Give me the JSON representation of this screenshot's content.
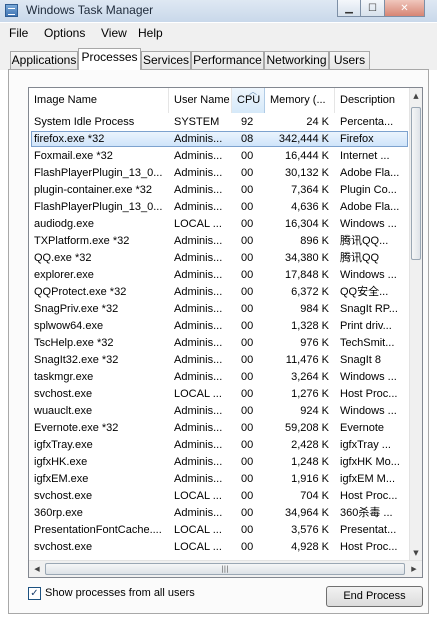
{
  "window": {
    "title": "Windows Task Manager",
    "controls": [
      "minimize",
      "maximize",
      "close"
    ]
  },
  "menu": [
    "File",
    "Options",
    "View",
    "Help"
  ],
  "tabs": [
    "Applications",
    "Processes",
    "Services",
    "Performance",
    "Networking",
    "Users"
  ],
  "active_tab": "Processes",
  "columns": [
    "Image Name",
    "User Name",
    "CPU",
    "Memory (...",
    "Description"
  ],
  "sorted_column": "CPU",
  "selected_row": 1,
  "rows": [
    {
      "name": "System Idle Process",
      "user": "SYSTEM",
      "cpu": "92",
      "mem": "24 K",
      "desc": "Percenta..."
    },
    {
      "name": "firefox.exe *32",
      "user": "Adminis...",
      "cpu": "08",
      "mem": "342,444 K",
      "desc": "Firefox"
    },
    {
      "name": "Foxmail.exe *32",
      "user": "Adminis...",
      "cpu": "00",
      "mem": "16,444 K",
      "desc": "Internet ..."
    },
    {
      "name": "FlashPlayerPlugin_13_0...",
      "user": "Adminis...",
      "cpu": "00",
      "mem": "30,132 K",
      "desc": "Adobe Fla..."
    },
    {
      "name": "plugin-container.exe *32",
      "user": "Adminis...",
      "cpu": "00",
      "mem": "7,364 K",
      "desc": "Plugin Co..."
    },
    {
      "name": "FlashPlayerPlugin_13_0...",
      "user": "Adminis...",
      "cpu": "00",
      "mem": "4,636 K",
      "desc": "Adobe Fla..."
    },
    {
      "name": "audiodg.exe",
      "user": "LOCAL ...",
      "cpu": "00",
      "mem": "16,304 K",
      "desc": "Windows ..."
    },
    {
      "name": "TXPlatform.exe *32",
      "user": "Adminis...",
      "cpu": "00",
      "mem": "896 K",
      "desc": "腾讯QQ..."
    },
    {
      "name": "QQ.exe *32",
      "user": "Adminis...",
      "cpu": "00",
      "mem": "34,380 K",
      "desc": "腾讯QQ"
    },
    {
      "name": "explorer.exe",
      "user": "Adminis...",
      "cpu": "00",
      "mem": "17,848 K",
      "desc": "Windows ..."
    },
    {
      "name": "QQProtect.exe *32",
      "user": "Adminis...",
      "cpu": "00",
      "mem": "6,372 K",
      "desc": "QQ安全..."
    },
    {
      "name": "SnagPriv.exe *32",
      "user": "Adminis...",
      "cpu": "00",
      "mem": "984 K",
      "desc": "SnagIt RP..."
    },
    {
      "name": "splwow64.exe",
      "user": "Adminis...",
      "cpu": "00",
      "mem": "1,328 K",
      "desc": "Print driv..."
    },
    {
      "name": "TscHelp.exe *32",
      "user": "Adminis...",
      "cpu": "00",
      "mem": "976 K",
      "desc": "TechSmit..."
    },
    {
      "name": "SnagIt32.exe *32",
      "user": "Adminis...",
      "cpu": "00",
      "mem": "11,476 K",
      "desc": "SnagIt 8"
    },
    {
      "name": "taskmgr.exe",
      "user": "Adminis...",
      "cpu": "00",
      "mem": "3,264 K",
      "desc": "Windows ..."
    },
    {
      "name": "svchost.exe",
      "user": "LOCAL ...",
      "cpu": "00",
      "mem": "1,276 K",
      "desc": "Host Proc..."
    },
    {
      "name": "wuauclt.exe",
      "user": "Adminis...",
      "cpu": "00",
      "mem": "924 K",
      "desc": "Windows ..."
    },
    {
      "name": "Evernote.exe *32",
      "user": "Adminis...",
      "cpu": "00",
      "mem": "59,208 K",
      "desc": "Evernote"
    },
    {
      "name": "igfxTray.exe",
      "user": "Adminis...",
      "cpu": "00",
      "mem": "2,428 K",
      "desc": "igfxTray ..."
    },
    {
      "name": "igfxHK.exe",
      "user": "Adminis...",
      "cpu": "00",
      "mem": "1,248 K",
      "desc": "igfxHK Mo..."
    },
    {
      "name": "igfxEM.exe",
      "user": "Adminis...",
      "cpu": "00",
      "mem": "1,916 K",
      "desc": "igfxEM M..."
    },
    {
      "name": "svchost.exe",
      "user": "LOCAL ...",
      "cpu": "00",
      "mem": "704 K",
      "desc": "Host Proc..."
    },
    {
      "name": "360rp.exe",
      "user": "Adminis...",
      "cpu": "00",
      "mem": "34,964 K",
      "desc": "360杀毒 ..."
    },
    {
      "name": "PresentationFontCache....",
      "user": "LOCAL ...",
      "cpu": "00",
      "mem": "3,576 K",
      "desc": "Presentat..."
    },
    {
      "name": "svchost.exe",
      "user": "LOCAL ...",
      "cpu": "00",
      "mem": "4,928 K",
      "desc": "Host Proc..."
    }
  ],
  "show_all_processes": {
    "label": "Show processes from all users",
    "checked": true
  },
  "end_process_label": "End Process",
  "icons": {
    "check": "✓",
    "minimize": "▁",
    "maximize": "☐",
    "close": "✕",
    "up": "▲",
    "down": "▼",
    "left": "◀",
    "right": "▶",
    "grip": "|||",
    "sort": "︿"
  }
}
